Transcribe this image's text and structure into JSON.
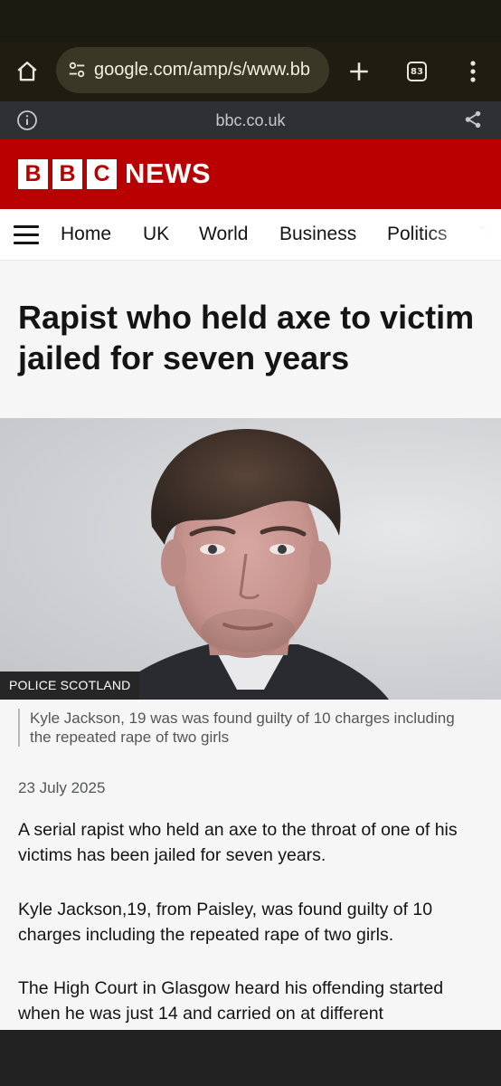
{
  "browser": {
    "url": "google.com/amp/s/www.bb",
    "tab_count": "83"
  },
  "amp_bar": {
    "domain": "bbc.co.uk"
  },
  "bbc_header": {
    "logo_letters": [
      "B",
      "B",
      "C"
    ],
    "brand": "NEWS",
    "brand_color": "#b80000"
  },
  "nav": {
    "items": [
      "Home",
      "UK",
      "World",
      "Business",
      "Politics",
      "Te"
    ]
  },
  "article": {
    "headline": "Rapist who held axe to victim jailed for seven years",
    "photo_credit": "POLICE SCOTLAND",
    "caption": "Kyle Jackson, 19 was was found guilty of 10 charges including the repeated rape of two girls",
    "date": "23 July 2025",
    "paragraphs": [
      "A serial rapist who held an axe to the throat of one of his victims has been jailed for seven years.",
      "Kyle Jackson,19, from Paisley, was found guilty of 10 charges including the repeated rape of two girls.",
      "The High Court in Glasgow heard his offending started when he was just 14 and carried on at different"
    ]
  },
  "icons": [
    "home-icon",
    "site-info-icon",
    "plus-icon",
    "tabs-icon",
    "more-vert-icon",
    "info-icon",
    "share-icon",
    "hamburger-icon"
  ]
}
